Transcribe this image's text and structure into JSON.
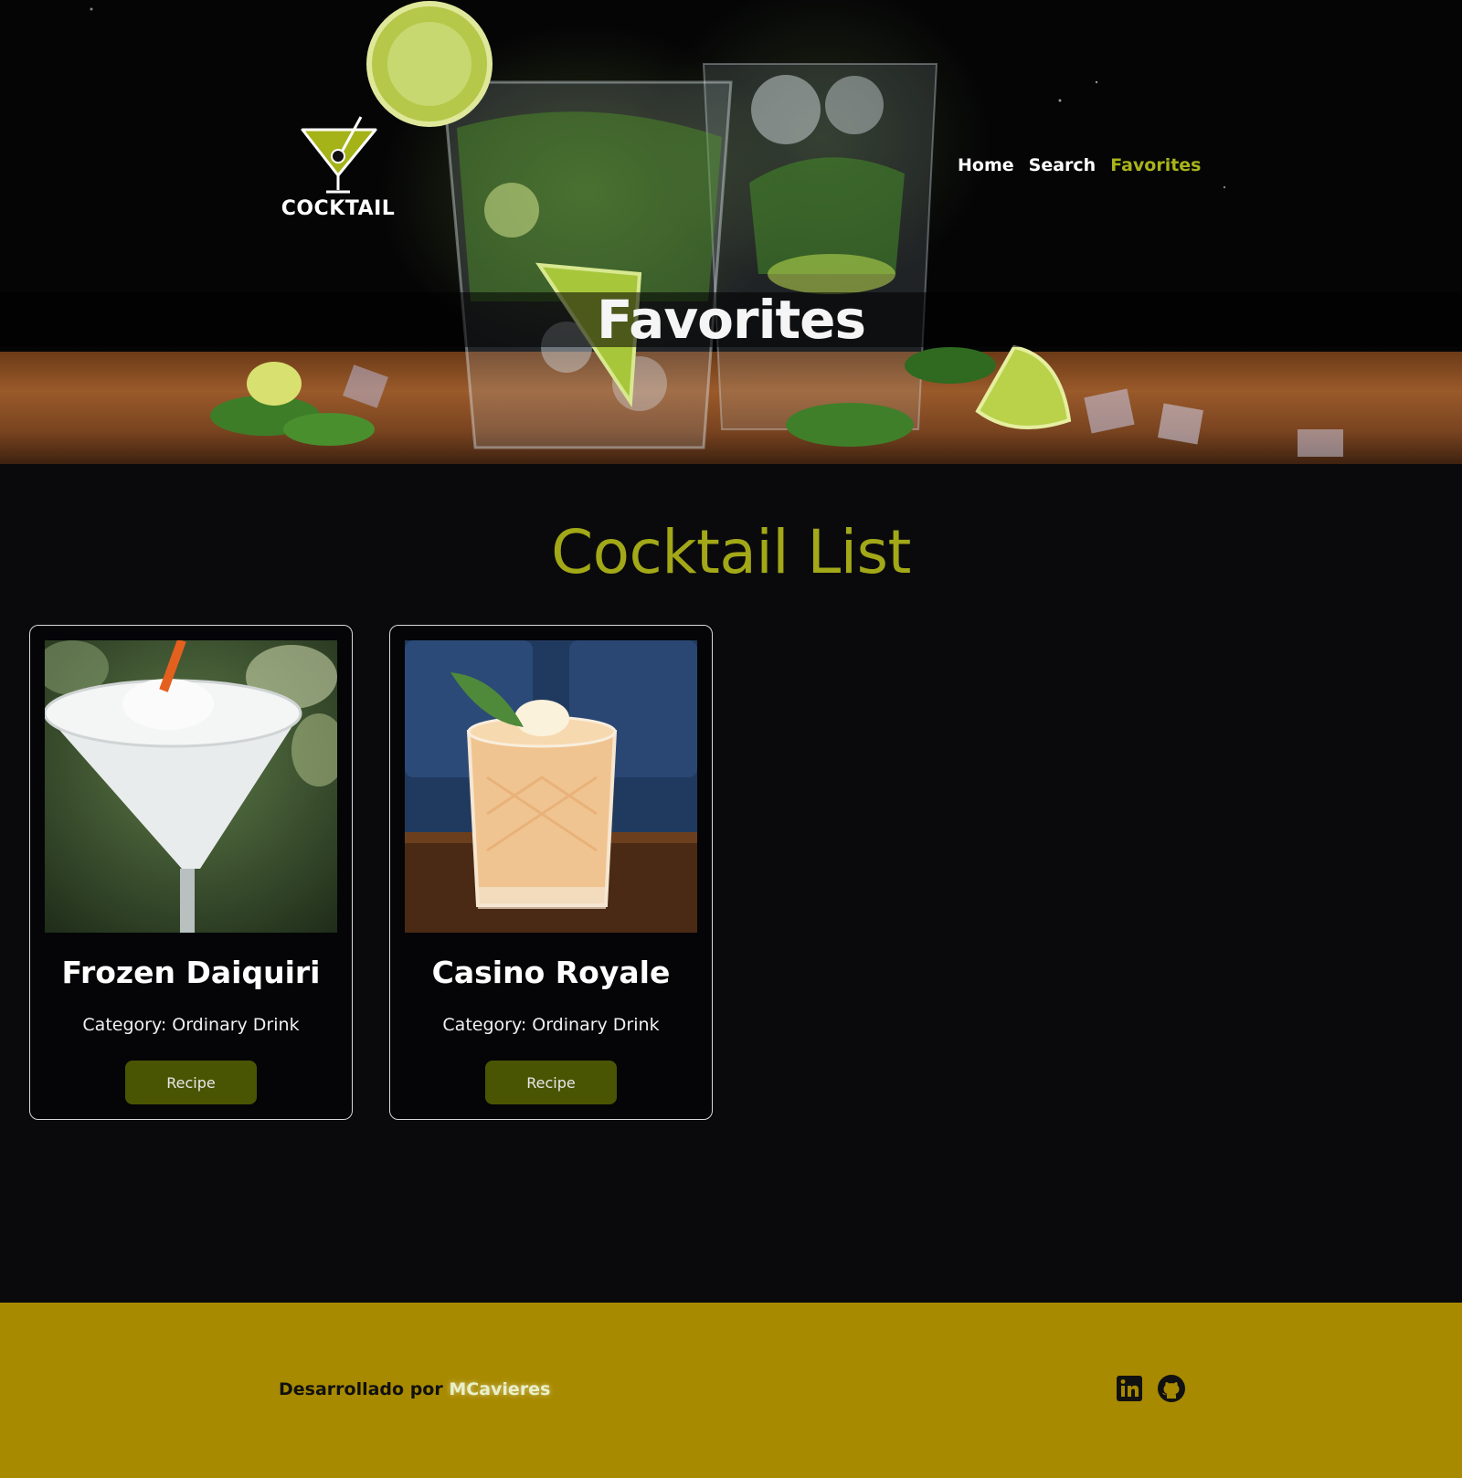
{
  "header": {
    "logo_text": "COCKTAIL",
    "nav": [
      {
        "label": "Home",
        "active": false
      },
      {
        "label": "Search",
        "active": false
      },
      {
        "label": "Favorites",
        "active": true
      }
    ],
    "page_title": "Favorites"
  },
  "main": {
    "section_title": "Cocktail List",
    "cards": [
      {
        "name": "Frozen Daiquiri",
        "category": "Category: Ordinary Drink",
        "button": "Recipe",
        "image": "frozen-daiquiri-photo"
      },
      {
        "name": "Casino Royale",
        "category": "Category: Ordinary Drink",
        "button": "Recipe",
        "image": "casino-royale-photo"
      }
    ]
  },
  "footer": {
    "credit_prefix": "Desarrollado por",
    "credit_name": "MCavieres",
    "socials": [
      "linkedin-icon",
      "github-icon"
    ]
  },
  "colors": {
    "background": "#0a0a0d",
    "accent": "#a2a817",
    "button": "#4a5503",
    "footer": "#a88a00"
  }
}
